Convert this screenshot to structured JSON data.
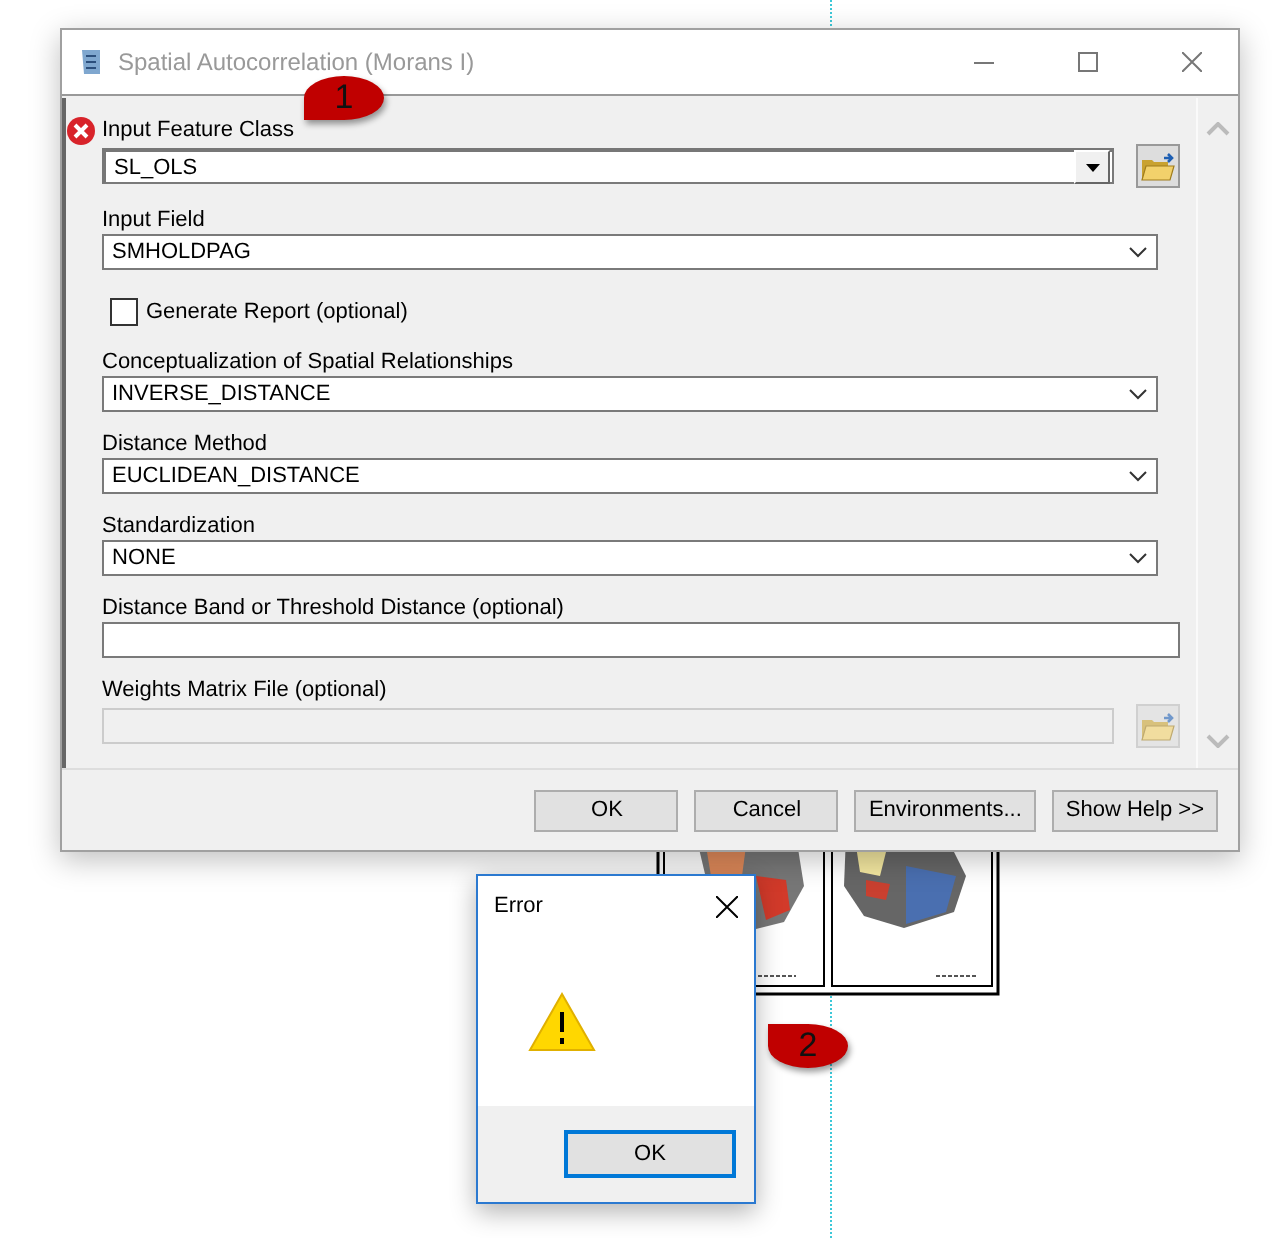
{
  "window": {
    "title": "Spatial Autocorrelation (Morans I)"
  },
  "fields": [
    {
      "kind": "combo",
      "label": "Input Feature Class",
      "value": "SL_OLS",
      "error": true
    },
    {
      "kind": "select",
      "label": "Input Field",
      "value": "SMHOLDPAG",
      "error": false
    },
    {
      "kind": "checkbox",
      "label": "Generate Report (optional)",
      "checked": false
    },
    {
      "kind": "select",
      "label": "Conceptualization of Spatial Relationships",
      "value": "INVERSE_DISTANCE",
      "error": false
    },
    {
      "kind": "select",
      "label": "Distance Method",
      "value": "EUCLIDEAN_DISTANCE",
      "error": false
    },
    {
      "kind": "select",
      "label": "Standardization",
      "value": "NONE",
      "error": false
    },
    {
      "kind": "text",
      "label": "Distance Band or Threshold Distance (optional)",
      "error": false
    },
    {
      "kind": "file",
      "label": "Weights Matrix File (optional)",
      "disabled": true,
      "error": false
    }
  ],
  "buttons": [
    {
      "label": "OK"
    },
    {
      "label": "Cancel"
    },
    {
      "label": "Environments..."
    },
    {
      "label": "Show Help >>"
    }
  ],
  "error_dialog": {
    "title": "Error",
    "button": "OK"
  },
  "callouts": [
    "1",
    "2"
  ]
}
